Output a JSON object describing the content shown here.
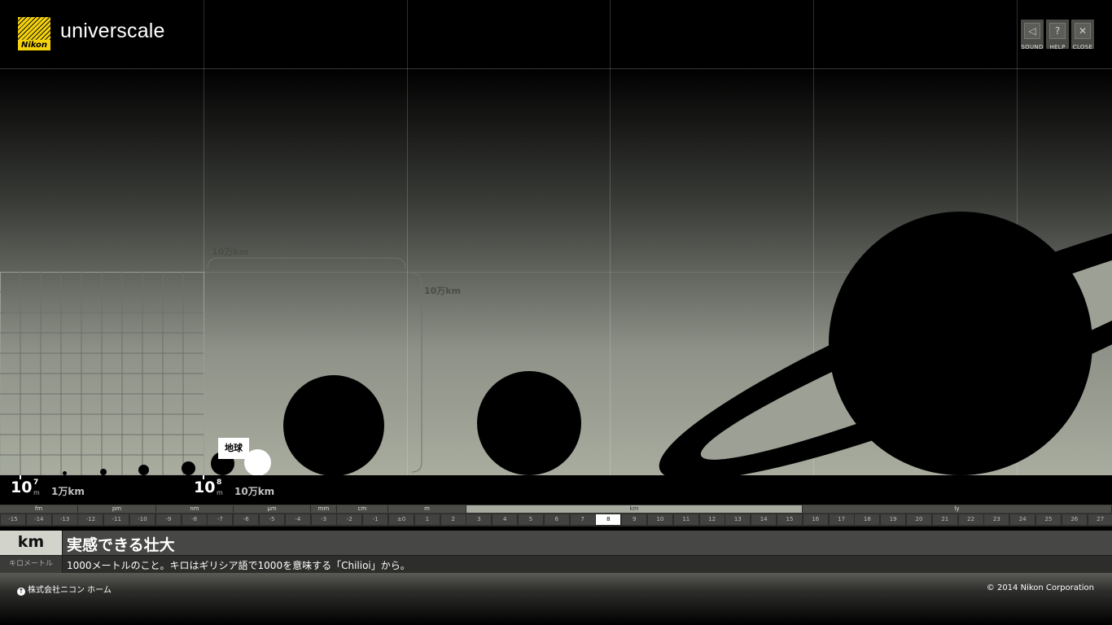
{
  "app": {
    "brand": "Nikon",
    "title": "universcale"
  },
  "controls": [
    {
      "name": "sound",
      "label": "SOUND",
      "icon": "speaker-icon"
    },
    {
      "name": "help",
      "label": "HELP",
      "icon": "question-icon"
    },
    {
      "name": "close",
      "label": "CLOSE",
      "icon": "close-icon"
    }
  ],
  "stage": {
    "bracket_width_label": "10万km",
    "bracket_height_label": "10万km",
    "earth_label": "地球"
  },
  "scale": [
    {
      "base": "10",
      "exp": "7",
      "unit": "m",
      "distance": "1万km"
    },
    {
      "base": "10",
      "exp": "8",
      "unit": "m",
      "distance": "10万km"
    }
  ],
  "unit_groups": [
    "fm",
    "pm",
    "nm",
    "μm",
    "mm",
    "cm",
    "m",
    "km",
    "ly"
  ],
  "active_unit_group": "km",
  "exponents": [
    "-15",
    "-14",
    "-13",
    "-12",
    "-11",
    "-10",
    "-9",
    "-8",
    "-7",
    "-6",
    "-5",
    "-4",
    "-3",
    "-2",
    "-1",
    "±0",
    "1",
    "2",
    "3",
    "4",
    "5",
    "6",
    "7",
    "8",
    "9",
    "10",
    "11",
    "12",
    "13",
    "14",
    "15",
    "16",
    "17",
    "18",
    "19",
    "20",
    "21",
    "22",
    "23",
    "24",
    "25",
    "26",
    "27"
  ],
  "selected_exponent": "8",
  "info": {
    "unit": "km",
    "reading": "キロメートル",
    "headline": "実感できる壮大",
    "description": "1000メートルのこと。キロはギリシア語で1000を意味する「Chilioi」から。"
  },
  "footer": {
    "home_link": "株式会社ニコン ホーム",
    "copyright": "© 2014 Nikon Corporation"
  },
  "colors": {
    "accent_active": "#a7aa9f",
    "background": "#000000",
    "selected_cell": "#ffffff"
  }
}
